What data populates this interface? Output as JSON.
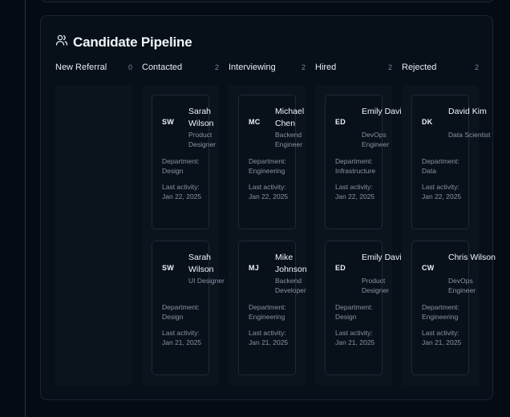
{
  "pipeline": {
    "title": "Candidate Pipeline",
    "icon": "users-icon",
    "columns": [
      {
        "name": "New Referral",
        "count": "0",
        "cards": []
      },
      {
        "name": "Contacted",
        "count": "2",
        "cards": [
          {
            "initials": "SW",
            "name": "Sarah Wilson",
            "role": "Product Designer",
            "department": "Department: Design",
            "activity": "Last activity: Jan 22, 2025"
          },
          {
            "initials": "SW",
            "name": "Sarah Wilson",
            "role": "UI Designer",
            "department": "Department: Design",
            "activity": "Last activity: Jan 21, 2025"
          }
        ]
      },
      {
        "name": "Interviewing",
        "count": "2",
        "cards": [
          {
            "initials": "MC",
            "name": "Michael Chen",
            "role": "Backend Engineer",
            "department": "Department: Engineering",
            "activity": "Last activity: Jan 22, 2025"
          },
          {
            "initials": "MJ",
            "name": "Mike Johnson",
            "role": "Backend Developer",
            "department": "Department: Engineering",
            "activity": "Last activity: Jan 21, 2025"
          }
        ]
      },
      {
        "name": "Hired",
        "count": "2",
        "cards": [
          {
            "initials": "ED",
            "name": "Emily Davis",
            "role": "DevOps Engineer",
            "department": "Department: Infrastructure",
            "activity": "Last activity: Jan 22, 2025"
          },
          {
            "initials": "ED",
            "name": "Emily Davis",
            "role": "Product Designer",
            "department": "Department: Design",
            "activity": "Last activity: Jan 21, 2025"
          }
        ]
      },
      {
        "name": "Rejected",
        "count": "2",
        "cards": [
          {
            "initials": "DK",
            "name": "David Kim",
            "role": "Data Scientist",
            "department": "Department: Data",
            "activity": "Last activity: Jan 22, 2025"
          },
          {
            "initials": "CW",
            "name": "Chris Wilson",
            "role": "DevOps Engineer",
            "department": "Department: Engineering",
            "activity": "Last activity: Jan 21, 2025"
          }
        ]
      }
    ]
  }
}
